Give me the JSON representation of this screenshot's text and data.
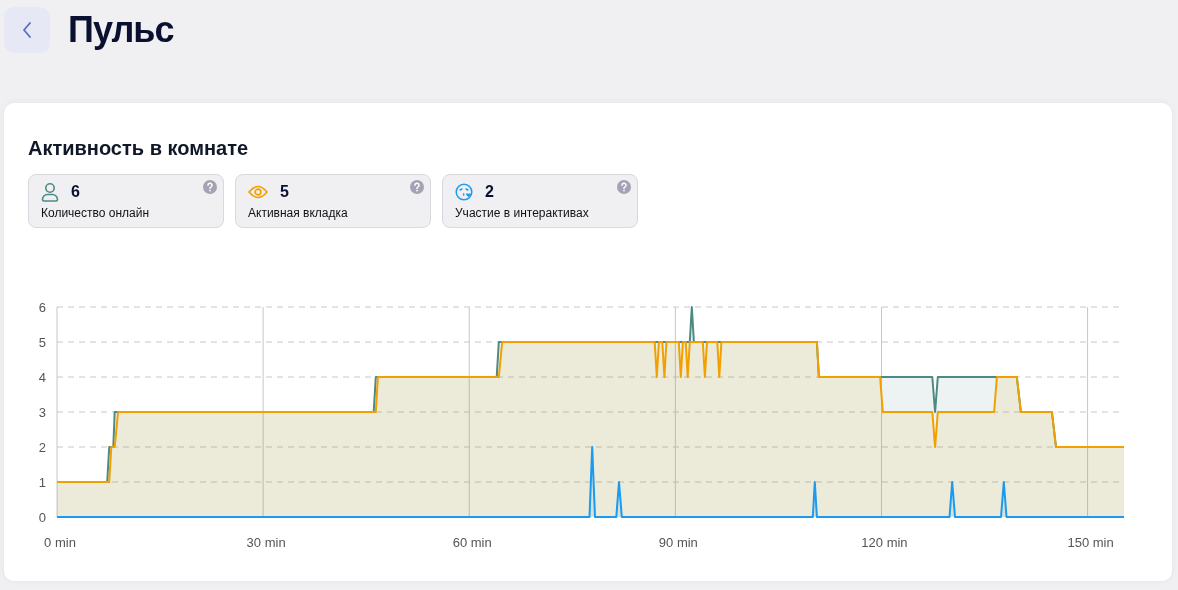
{
  "header": {
    "title": "Пульс"
  },
  "panel": {
    "title": "Активность в комнате",
    "stats": [
      {
        "kind": "person",
        "value": "6",
        "label": "Количество онлайн",
        "color": "#4e8a84"
      },
      {
        "kind": "eye",
        "value": "5",
        "label": "Активная вкладка",
        "color": "#f0a000"
      },
      {
        "kind": "smiley",
        "value": "2",
        "label": "Участие в интерактивах",
        "color": "#1a9af0"
      }
    ],
    "chart_data": {
      "type": "area",
      "x": [
        0,
        7.3,
        7.6,
        7.9,
        8.2,
        8.4,
        8.9,
        46.1,
        46.4,
        46.7,
        64.0,
        64.3,
        64.8,
        77.5,
        77.9,
        78.3,
        81.4,
        81.8,
        82.2,
        87.0,
        87.3,
        87.6,
        88.1,
        88.4,
        88.7,
        90.5,
        90.8,
        91.1,
        91.5,
        91.8,
        92.1,
        92.4,
        92.7,
        94.0,
        94.3,
        94.6,
        96.1,
        96.4,
        96.7,
        110.0,
        110.3,
        110.6,
        110.9,
        119.8,
        120.2,
        127.4,
        127.8,
        128.2,
        129.9,
        130.3,
        130.7,
        136.4,
        136.8,
        137.4,
        137.8,
        138.2,
        139.7,
        140.3,
        144.8,
        145.4,
        155.3
      ],
      "series": [
        {
          "color": "#4e8a84",
          "values": [
            1,
            1,
            2,
            2,
            2,
            3,
            3,
            3,
            4,
            4,
            4,
            5,
            5,
            5,
            5,
            5,
            5,
            5,
            5,
            5,
            5,
            5,
            5,
            5,
            5,
            5,
            5,
            5,
            5,
            5,
            5,
            6,
            5,
            5,
            5,
            5,
            5,
            5,
            5,
            5,
            5,
            5,
            4,
            4,
            4,
            4,
            3,
            4,
            4,
            4,
            4,
            4,
            4,
            4,
            4,
            4,
            4,
            3,
            3,
            2,
            2
          ]
        },
        {
          "color": "#f0a000",
          "values": [
            1,
            1,
            1,
            2,
            2,
            2,
            3,
            3,
            3,
            4,
            4,
            4,
            5,
            5,
            5,
            5,
            5,
            5,
            5,
            5,
            4,
            5,
            5,
            4,
            5,
            5,
            4,
            5,
            5,
            4,
            5,
            5,
            5,
            5,
            4,
            5,
            5,
            4,
            5,
            5,
            5,
            5,
            4,
            4,
            3,
            3,
            2,
            3,
            3,
            3,
            3,
            3,
            4,
            4,
            4,
            4,
            4,
            3,
            3,
            2,
            2
          ]
        },
        {
          "color": "#1a9af0",
          "values": [
            0,
            0,
            0,
            0,
            0,
            0,
            0,
            0,
            0,
            0,
            0,
            0,
            0,
            0,
            2,
            0,
            0,
            1,
            0,
            0,
            0,
            0,
            0,
            0,
            0,
            0,
            0,
            0,
            0,
            0,
            0,
            0,
            0,
            0,
            0,
            0,
            0,
            0,
            0,
            0,
            1,
            0,
            0,
            0,
            0,
            0,
            0,
            0,
            0,
            1,
            0,
            0,
            0,
            0,
            1,
            0,
            0,
            0,
            0,
            0,
            0
          ]
        }
      ],
      "grid": true,
      "xlim": [
        0,
        155.3
      ],
      "ylim": [
        0,
        6
      ],
      "yticks": [
        0,
        1,
        2,
        3,
        4,
        5,
        6
      ],
      "xticks": [
        {
          "value": 0,
          "label": "0 min"
        },
        {
          "value": 30,
          "label": "30 min"
        },
        {
          "value": 60,
          "label": "60 min"
        },
        {
          "value": 90,
          "label": "90 min"
        },
        {
          "value": 120,
          "label": "120 min"
        },
        {
          "value": 150,
          "label": "150 min"
        }
      ]
    }
  }
}
